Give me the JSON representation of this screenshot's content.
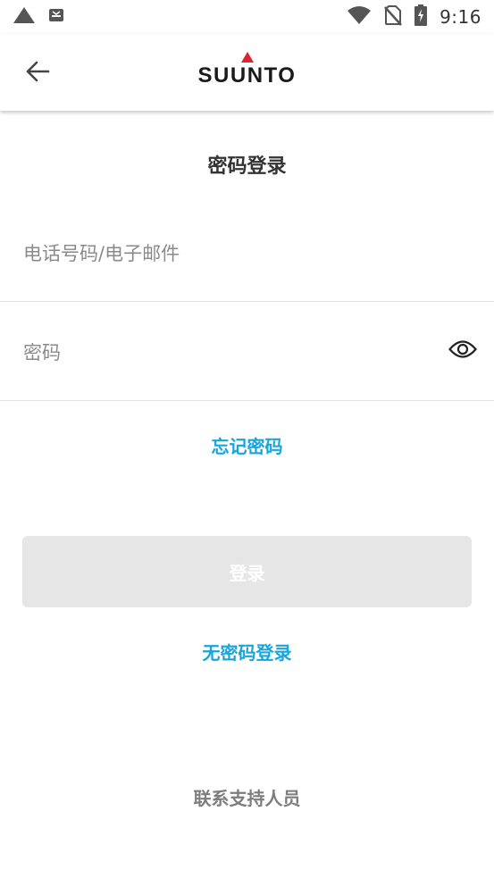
{
  "status_bar": {
    "time": "9:16",
    "icons": [
      "triangle-icon",
      "app-notification-icon",
      "wifi-icon",
      "no-sim-icon",
      "battery-charging-icon"
    ]
  },
  "app_bar": {
    "back_icon": "arrow-left-icon",
    "logo_text": "SUUNTO",
    "logo_color": "#e0232f"
  },
  "login": {
    "title": "密码登录",
    "phone_email_placeholder": "电话号码/电子邮件",
    "phone_email_value": "",
    "password_placeholder": "密码",
    "password_value": "",
    "show_password_icon": "eye-icon",
    "forgot_password": "忘记密码",
    "login_button": "登录",
    "passwordless_login": "无密码登录",
    "contact_support": "联系支持人员"
  },
  "colors": {
    "accent": "#16a6dd",
    "button_disabled": "#e6e6e6"
  }
}
